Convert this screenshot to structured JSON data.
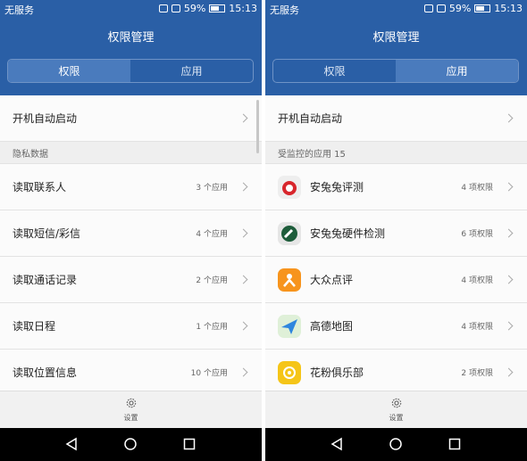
{
  "left": {
    "status": {
      "carrier": "无服务",
      "battery": "59%",
      "time": "15:13"
    },
    "title": "权限管理",
    "tabs": [
      "权限",
      "应用"
    ],
    "autostart_label": "开机自动启动",
    "section_label": "隐私数据",
    "items": [
      {
        "label": "读取联系人",
        "count": "3 个应用"
      },
      {
        "label": "读取短信/彩信",
        "count": "4 个应用"
      },
      {
        "label": "读取通话记录",
        "count": "2 个应用"
      },
      {
        "label": "读取日程",
        "count": "1 个应用"
      },
      {
        "label": "读取位置信息",
        "count": "10 个应用"
      }
    ],
    "settings_label": "设置"
  },
  "right": {
    "status": {
      "carrier": "无服务",
      "battery": "59%",
      "time": "15:13"
    },
    "title": "权限管理",
    "tabs": [
      "权限",
      "应用"
    ],
    "autostart_label": "开机自动启动",
    "section_label": "受监控的应用 15",
    "apps": [
      {
        "name": "安兔兔评测",
        "count": "4 项权限",
        "icon": "antutu-icon"
      },
      {
        "name": "安兔兔硬件检测",
        "count": "6 项权限",
        "icon": "antutu-hardware-icon"
      },
      {
        "name": "大众点评",
        "count": "4 项权限",
        "icon": "dianping-icon"
      },
      {
        "name": "高德地图",
        "count": "4 项权限",
        "icon": "amap-icon"
      },
      {
        "name": "花粉俱乐部",
        "count": "2 项权限",
        "icon": "huafen-icon"
      }
    ],
    "settings_label": "设置"
  },
  "colors": {
    "header": "#2a5fa6",
    "active_tab": "#4a7bbd",
    "navbar": "#000000"
  }
}
